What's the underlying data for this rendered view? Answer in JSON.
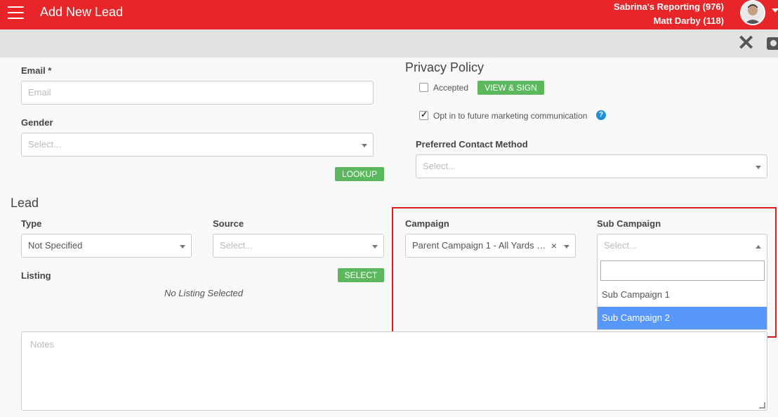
{
  "header": {
    "title": "Add New Lead",
    "reporting_line": "Sabrina's Reporting (976)",
    "user_line": "Matt Darby (118)"
  },
  "toolbar": {
    "close_glyph": "✕"
  },
  "contact": {
    "email_label": "Email *",
    "email_placeholder": "Email",
    "gender_label": "Gender",
    "gender_placeholder": "Select...",
    "lookup_label": "LOOKUP"
  },
  "privacy": {
    "title": "Privacy Policy",
    "accepted_label": "Accepted",
    "accepted_checked": false,
    "view_sign_label": "VIEW & SIGN",
    "opt_in_label": "Opt in to future marketing communication",
    "opt_in_checked": true,
    "help_glyph": "?",
    "preferred_contact_label": "Preferred Contact Method",
    "preferred_contact_placeholder": "Select..."
  },
  "lead": {
    "title": "Lead",
    "type_label": "Type",
    "type_value": "Not Specified",
    "source_label": "Source",
    "source_placeholder": "Select...",
    "campaign_label": "Campaign",
    "campaign_value": "Parent Campaign 1 - All Yards &...",
    "campaign_clear": "×",
    "sub_campaign_label": "Sub Campaign",
    "sub_campaign_placeholder": "Select...",
    "sub_campaign_options": [
      "Sub Campaign 1",
      "Sub Campaign 2"
    ],
    "sub_campaign_highlighted": "Sub Campaign 2",
    "listing_label": "Listing",
    "select_button_label": "SELECT",
    "no_listing_text": "No Listing Selected",
    "notes_placeholder": "Notes"
  },
  "colors": {
    "header_bg": "#e8262a",
    "button_green": "#5cb85c",
    "highlight_option": "#5897fb",
    "annotation_red": "#d9201f"
  }
}
